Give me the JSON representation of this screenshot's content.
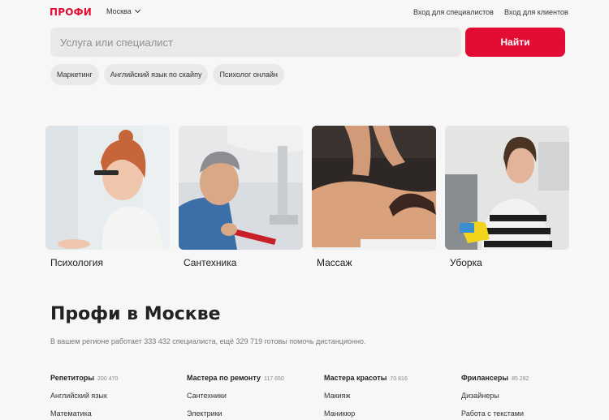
{
  "header": {
    "logo": "ПРОФИ",
    "city": "Москва",
    "login_specialists": "Вход для специалистов",
    "login_clients": "Вход для клиентов"
  },
  "search": {
    "placeholder": "Услуга или специалист",
    "button_label": "Найти"
  },
  "chips": [
    "Маркетинг",
    "Английский язык по скайпу",
    "Психолог онлайн"
  ],
  "categories": [
    {
      "label": "Психология"
    },
    {
      "label": "Сантехника"
    },
    {
      "label": "Массаж"
    },
    {
      "label": "Уборка"
    }
  ],
  "section": {
    "title": "Профи в Москве",
    "subtitle": "В вашем регионе работает 333 432 специалиста, ещё 329 719 готовы помочь дистанционно."
  },
  "columns": [
    {
      "title": "Репетиторы",
      "count": "200 470",
      "items": [
        "Английский язык",
        "Математика"
      ]
    },
    {
      "title": "Мастера по ремонту",
      "count": "117 650",
      "items": [
        "Сантехники",
        "Электрики"
      ]
    },
    {
      "title": "Мастера красоты",
      "count": "70 816",
      "items": [
        "Макияж",
        "Маникюр"
      ]
    },
    {
      "title": "Фрилансеры",
      "count": "85 282",
      "items": [
        "Дизайнеры",
        "Работа с текстами"
      ]
    }
  ],
  "colors": {
    "accent": "#e30d34",
    "background": "#f7f7f7",
    "chip": "#e9e9e9"
  }
}
